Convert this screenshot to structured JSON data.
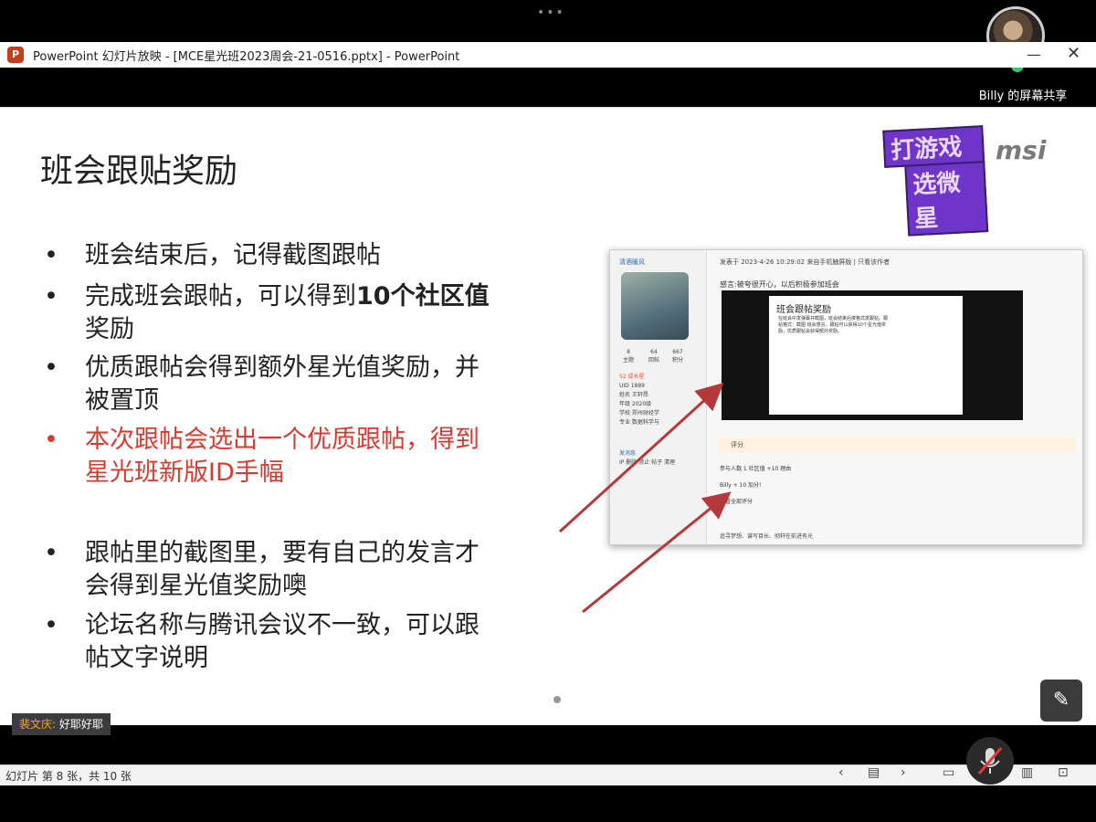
{
  "meeting": {
    "dots": "•••",
    "share_label": "Billy 的屏幕共享"
  },
  "window": {
    "title": "PowerPoint 幻灯片放映 - [MCE星光班2023周会-21-0516.pptx] - PowerPoint",
    "app_icon": "P"
  },
  "slide": {
    "title": "班会跟贴奖励",
    "bullets": [
      {
        "line1": "班会结束后，记得截图跟帖",
        "line2": "",
        "bold": "",
        "color": "normal"
      },
      {
        "line1": "完成班会跟帖，可以得到",
        "bold": "10个社区值",
        "line2": "奖励",
        "color": "normal"
      },
      {
        "line1": "优质跟帖会得到额外星光值奖励，并",
        "line2": "被置顶",
        "bold": "",
        "color": "normal"
      },
      {
        "line1": "本次跟帖会选出一个优质跟帖，得到",
        "line2": "星光班新版ID手幅",
        "bold": "",
        "color": "red"
      },
      {
        "line1": "跟帖里的截图里，要有自己的发言才",
        "line2": "会得到星光值奖励噢",
        "bold": "",
        "color": "normal"
      },
      {
        "line1": "论坛名称与腾讯会议不一致，可以跟",
        "line2": "帖文字说明",
        "bold": "",
        "color": "normal"
      }
    ],
    "bullet_dot": "•",
    "logo_line1": "打游戏",
    "logo_line2": "选微星",
    "logo_brand": "msi",
    "accent_red": "#d93a30"
  },
  "screenshot": {
    "username": "清酒暖风",
    "stats": [
      {
        "value": "8",
        "label": "主题"
      },
      {
        "value": "64",
        "label": "回帖"
      },
      {
        "value": "667",
        "label": "积分"
      }
    ],
    "profile": [
      "52 成长星",
      "UID   1889",
      "姓名   王轩昂",
      "年级   2020级",
      "学校   郑州财经学",
      "专业   数据科学与"
    ],
    "send_msg": "发消息",
    "ip_line": "IP 删除 禁止 帖子 清理",
    "post_meta": "发表于 2023-4-26 10:29:02 来自手机触屏版 | 只看该作者",
    "post_text": "感言:被夸很开心，以后积极参加班会",
    "inner_title": "班会跟帖奖励",
    "inner_text": "在班会中发弹幕并截图，班会结束后按格式发跟帖。跟帖格式：截图 班会感言。跟帖可以获得10个星光值奖励，优质跟帖会获得额外奖励。",
    "rating_label": "评分",
    "rate_head": "参与人数 1      社区值 +10    理由",
    "rate_row": "Billy      + 10      加分!",
    "more": "查看全部评分",
    "signature": "追寻梦想、谱写目长、彻轩在前进有光"
  },
  "subtitle": {
    "speaker": "裴文庆:",
    "text": "好耶好耶"
  },
  "statusbar": {
    "slide_counter": "幻灯片 第 8 张，共 10 张",
    "prev": "‹",
    "next": "›"
  }
}
